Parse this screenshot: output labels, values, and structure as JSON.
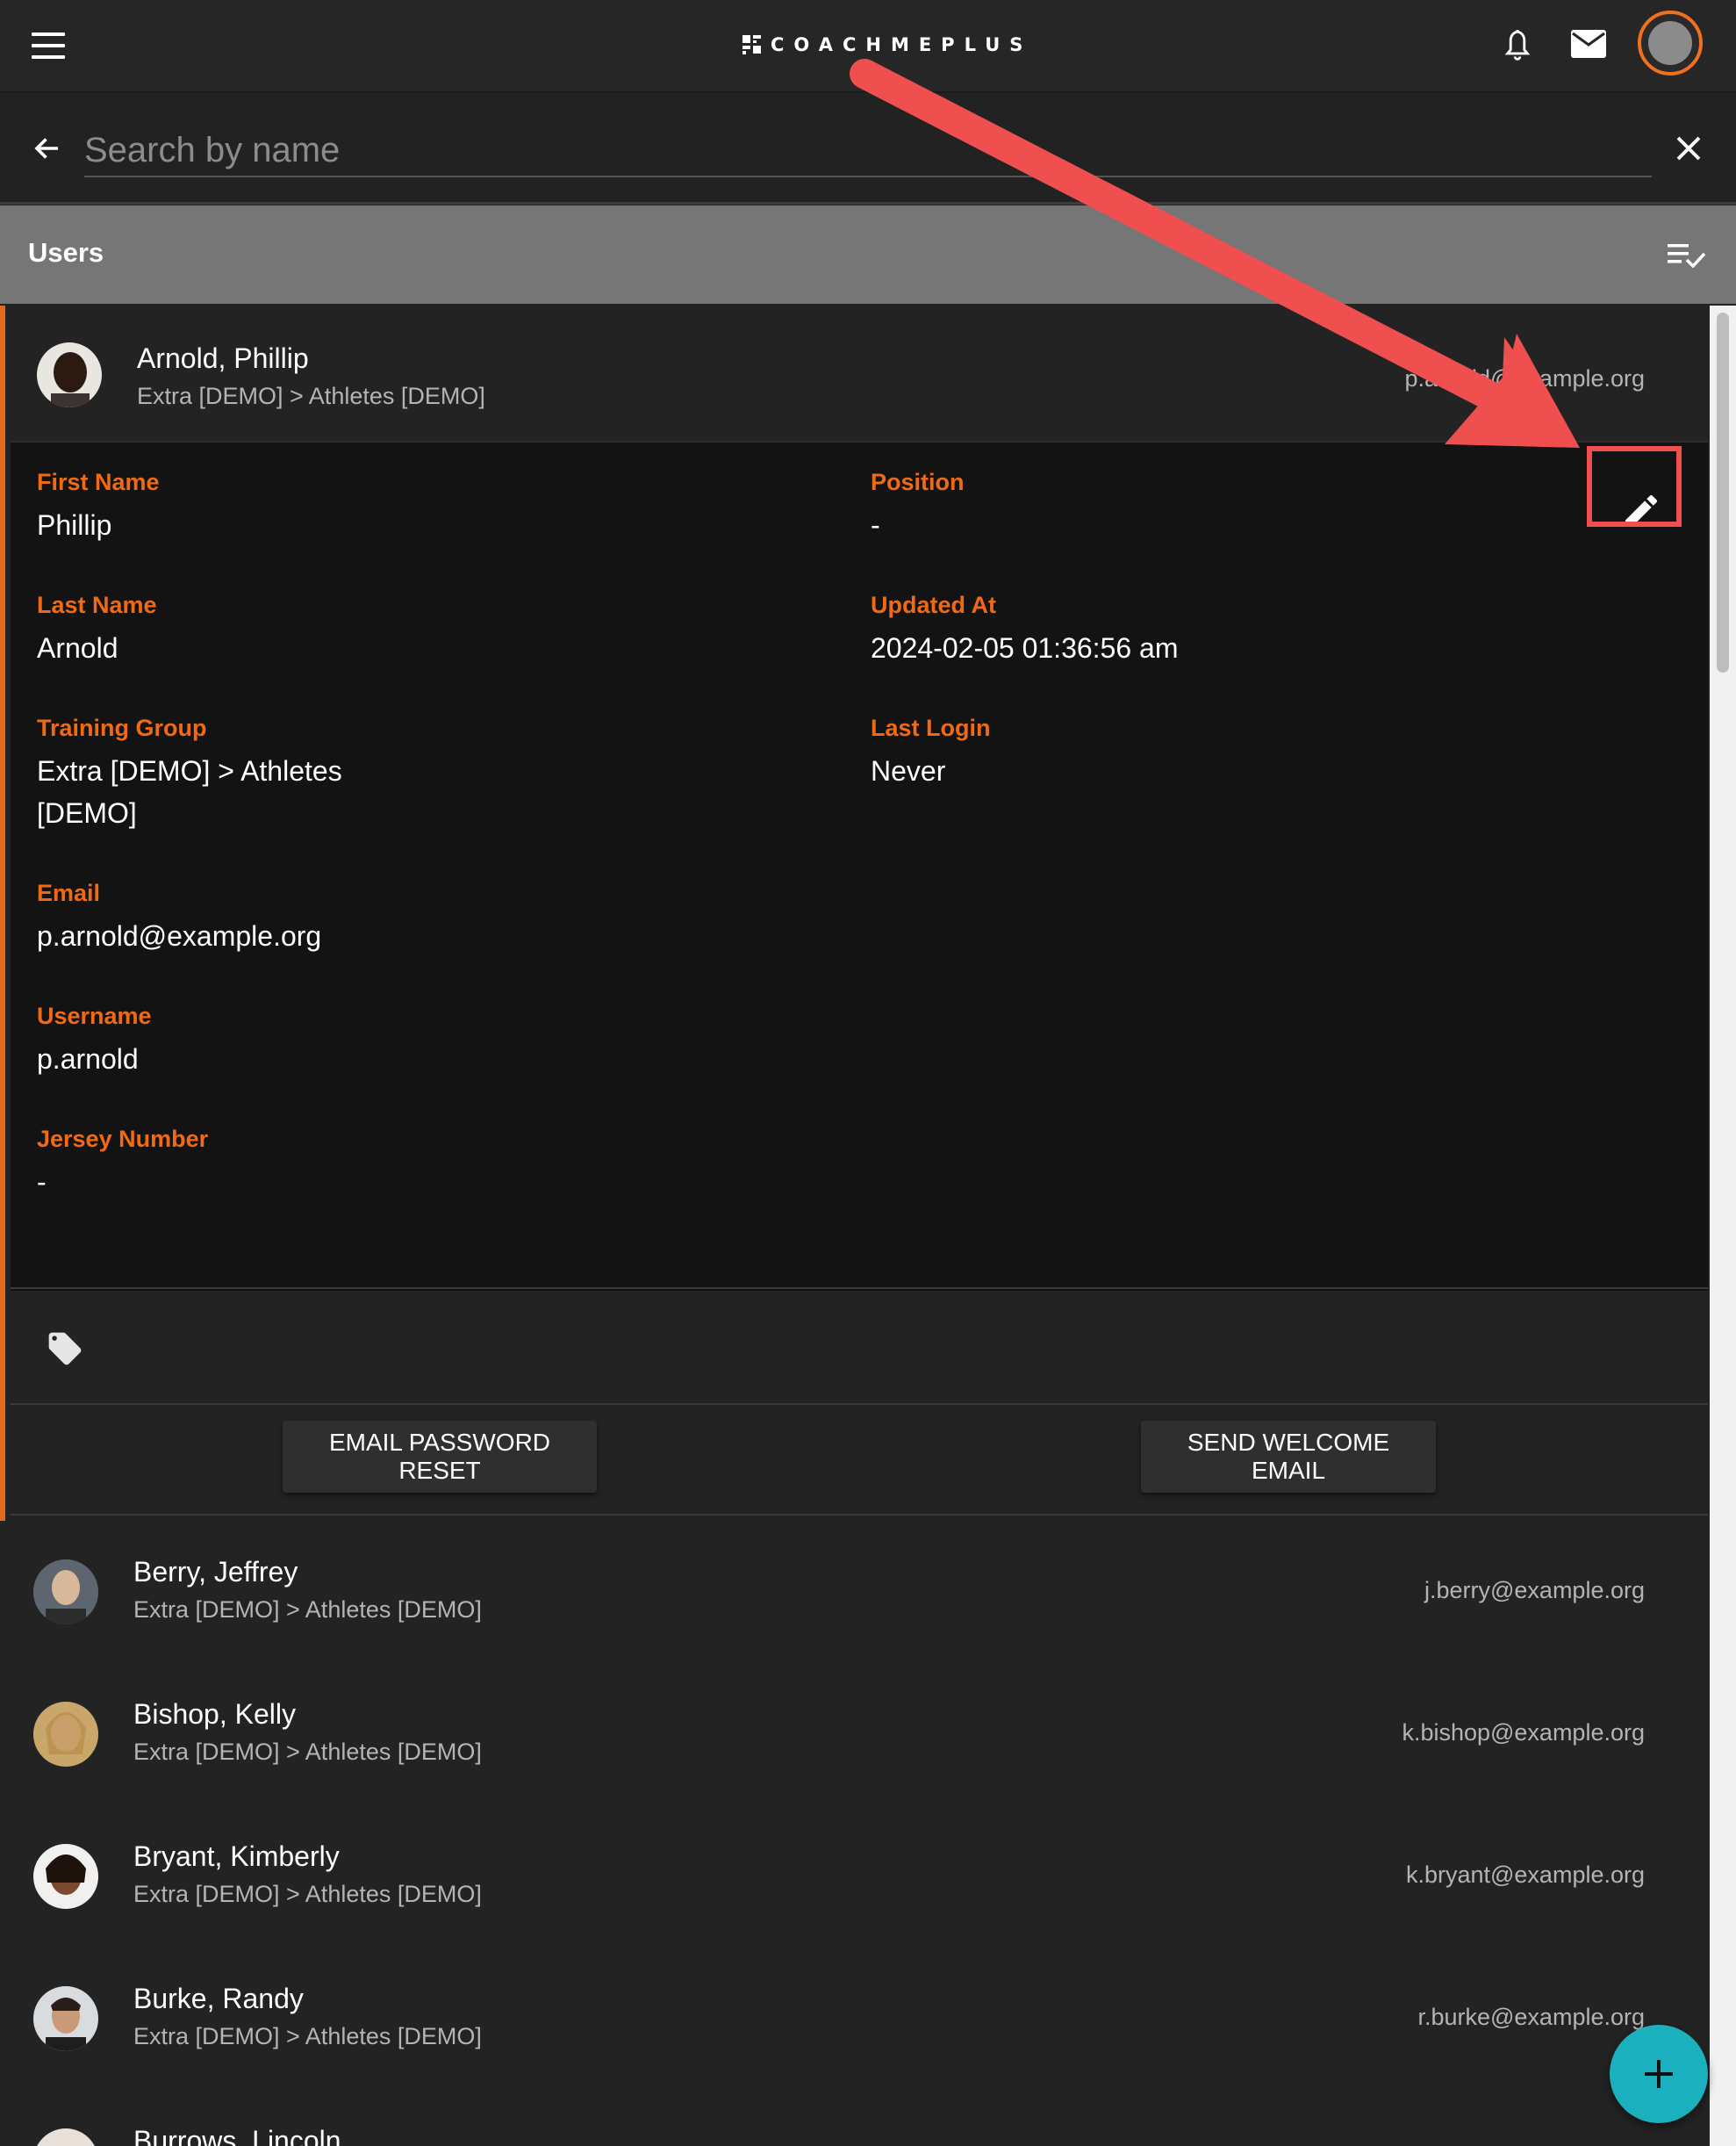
{
  "header": {
    "logo_text": "COACHMEPLUS",
    "icons": [
      "menu-icon",
      "bell-icon",
      "mail-icon",
      "profile-avatar"
    ]
  },
  "search": {
    "placeholder": "Search by name",
    "value": ""
  },
  "section": {
    "title": "Users"
  },
  "expanded_user": {
    "name": "Arnold, Phillip",
    "group": "Extra [DEMO] > Athletes [DEMO]",
    "email_right": "p.arnold@example.org",
    "fields": {
      "first_name": {
        "label": "First Name",
        "value": "Phillip"
      },
      "position": {
        "label": "Position",
        "value": "-"
      },
      "last_name": {
        "label": "Last Name",
        "value": "Arnold"
      },
      "updated_at": {
        "label": "Updated At",
        "value": "2024-02-05 01:36:56 am"
      },
      "training_group": {
        "label": "Training Group",
        "value_line1": "Extra [DEMO] > Athletes",
        "value_line2": "[DEMO]"
      },
      "last_login": {
        "label": "Last Login",
        "value": "Never"
      },
      "email": {
        "label": "Email",
        "value": "p.arnold@example.org"
      },
      "username": {
        "label": "Username",
        "value": "p.arnold"
      },
      "jersey_number": {
        "label": "Jersey Number",
        "value": "-"
      }
    },
    "buttons": {
      "email_password_reset": "EMAIL PASSWORD RESET",
      "send_welcome_email": "SEND WELCOME EMAIL"
    }
  },
  "users": [
    {
      "name": "Berry, Jeffrey",
      "group": "Extra [DEMO] > Athletes [DEMO]",
      "email": "j.berry@example.org"
    },
    {
      "name": "Bishop, Kelly",
      "group": "Extra [DEMO] > Athletes [DEMO]",
      "email": "k.bishop@example.org"
    },
    {
      "name": "Bryant, Kimberly",
      "group": "Extra [DEMO] > Athletes [DEMO]",
      "email": "k.bryant@example.org"
    },
    {
      "name": "Burke, Randy",
      "group": "Extra [DEMO] > Athletes [DEMO]",
      "email": "r.burke@example.org"
    },
    {
      "name": "Burrows, Lincoln",
      "group": "",
      "email": ""
    }
  ],
  "colors": {
    "accent_orange": "#f06a16",
    "annotation_red": "#ef4f4f",
    "fab_teal": "#1ab0bd"
  }
}
